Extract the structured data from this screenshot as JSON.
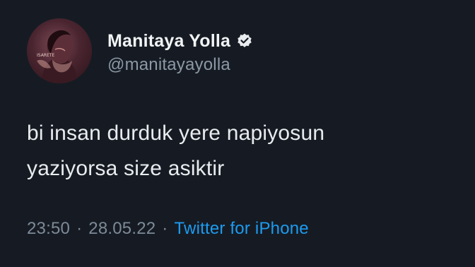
{
  "tweet": {
    "author": {
      "display_name": "Manitaya Yolla",
      "handle": "@manitayayolla",
      "verified": true,
      "avatar_caption": "ISARETE"
    },
    "text_lines": [
      "bi insan durduk yere napiyosun",
      "yaziyorsa size asiktir"
    ],
    "time": "23:50",
    "date": "28.05.22",
    "separator": "·",
    "source": "Twitter for iPhone"
  },
  "colors": {
    "background": "#161b23",
    "accent": "#1d9bf0",
    "secondary_text": "#7d8a97"
  },
  "icons": {
    "verified": "verified-badge-icon"
  }
}
